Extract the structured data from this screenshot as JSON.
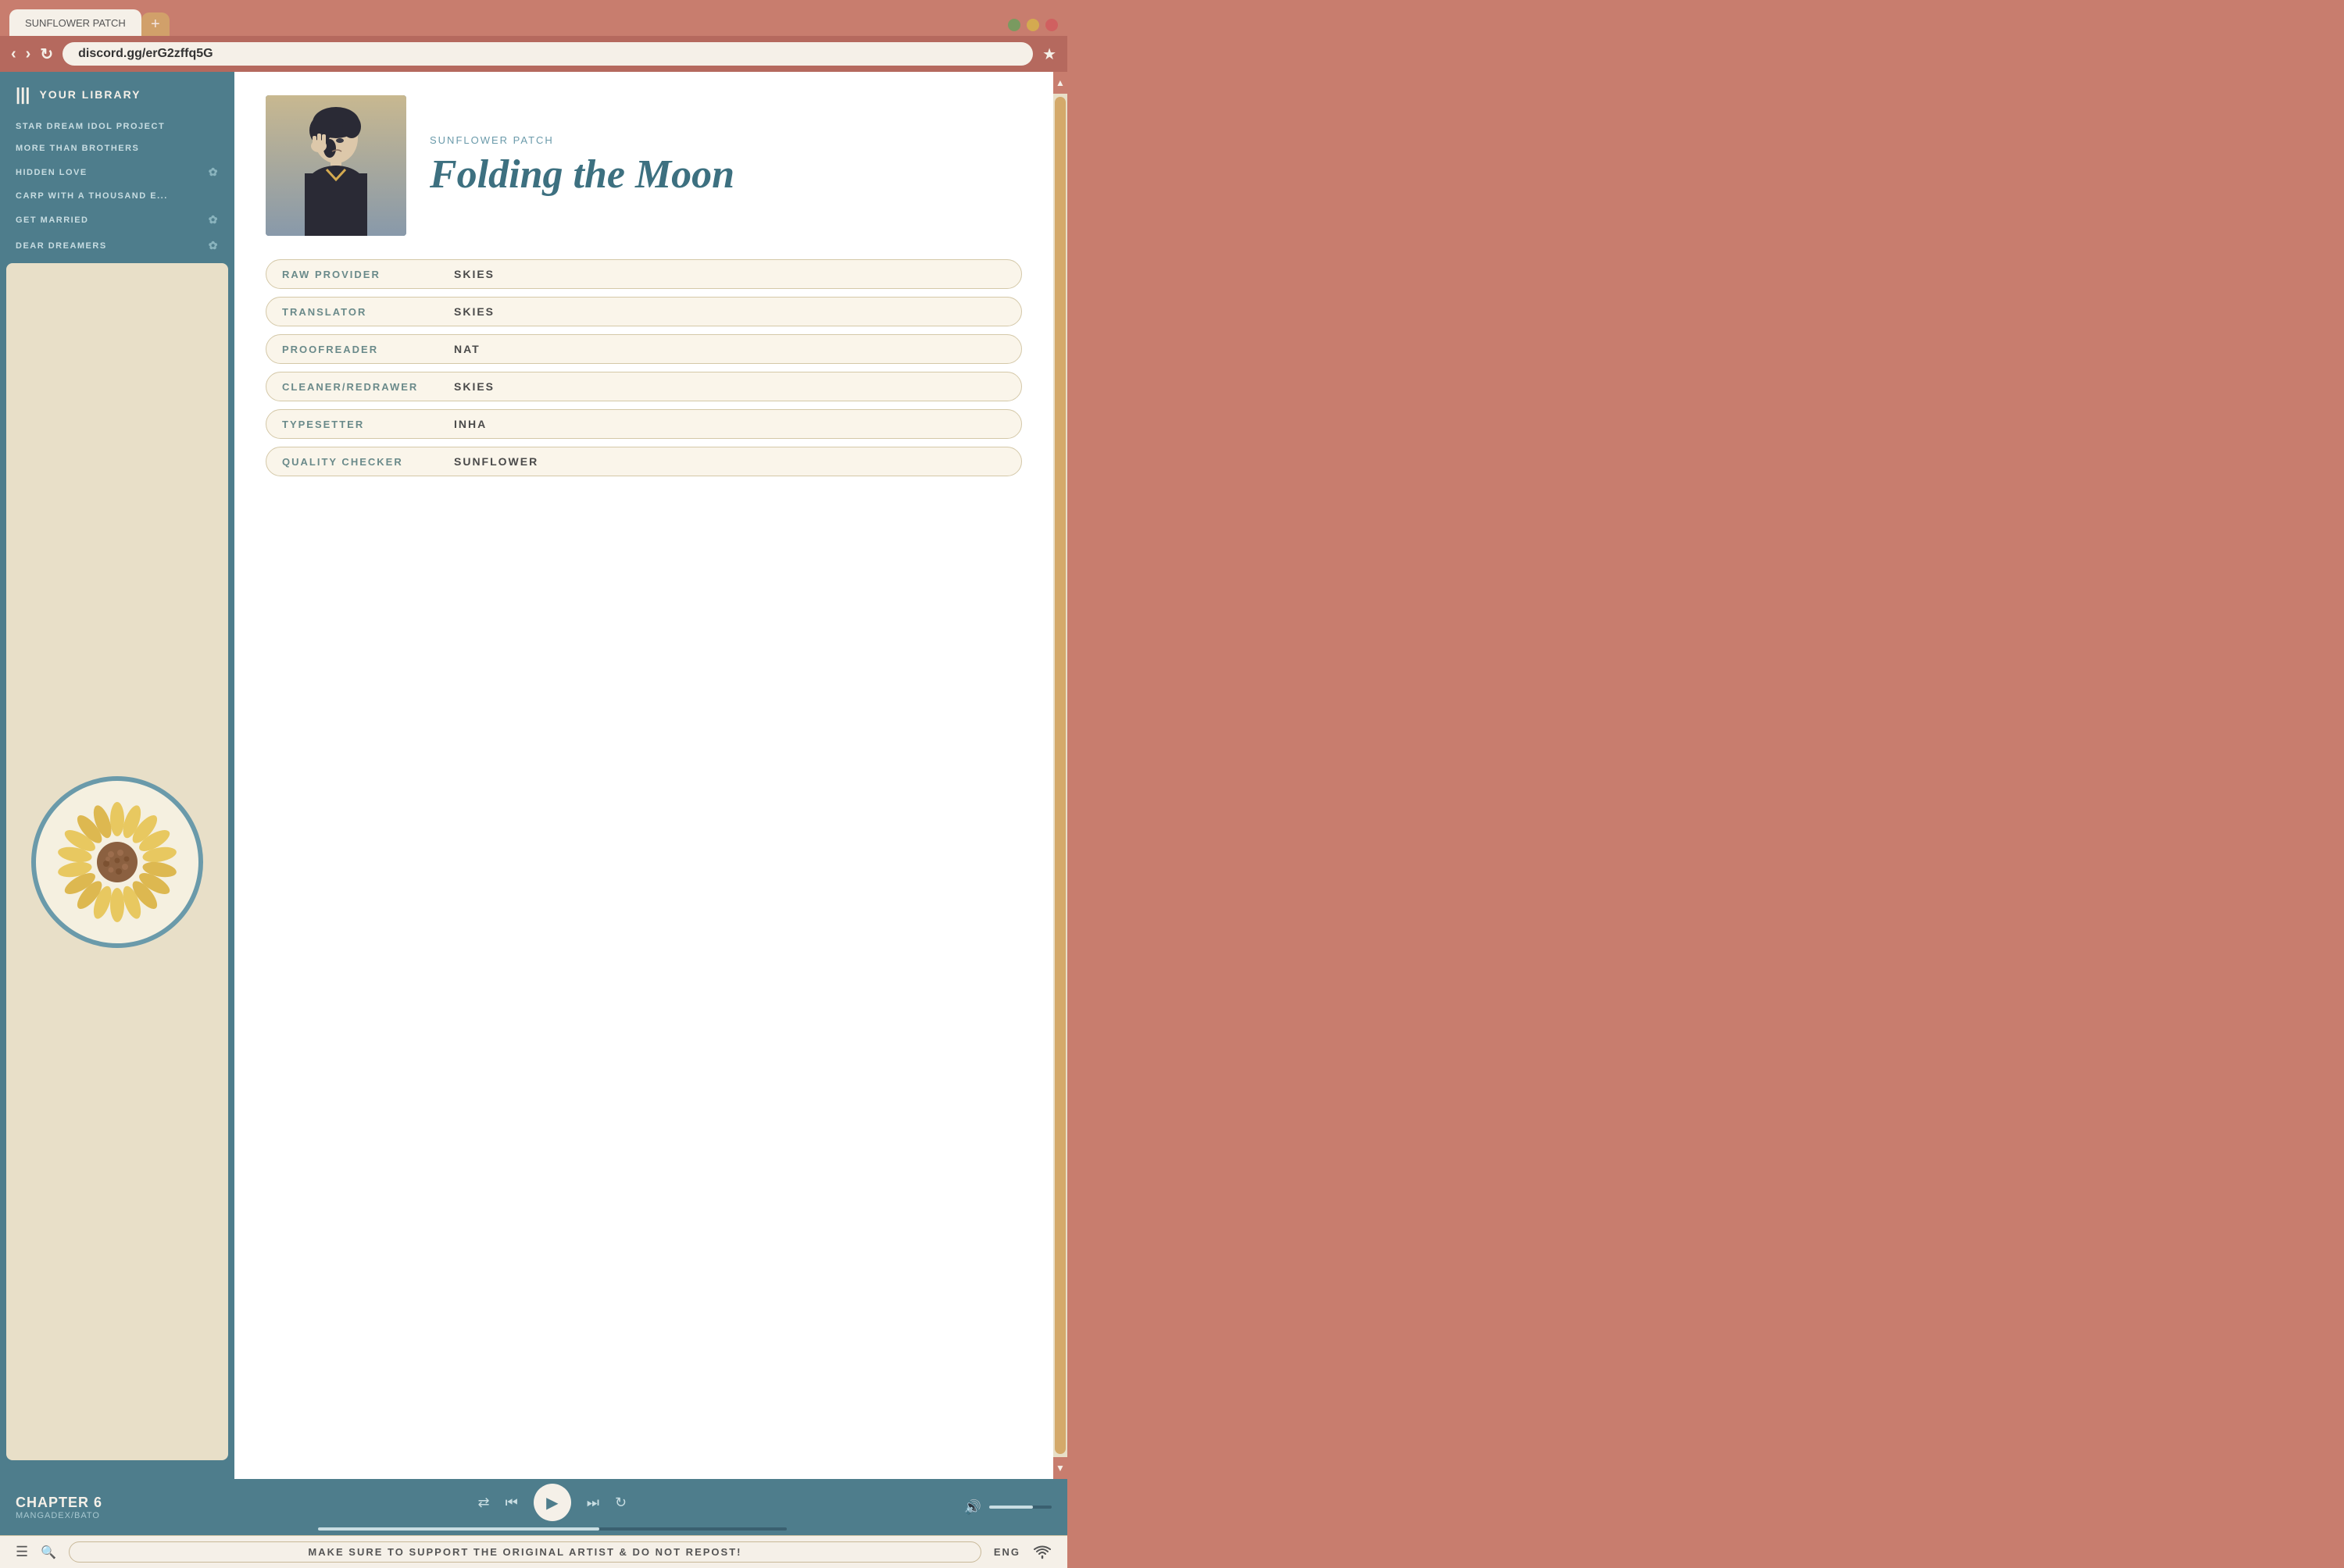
{
  "browser": {
    "tab_label": "SUNFLOWER PATCH",
    "tab_new_icon": "+",
    "url": "discord.gg/erG2zffq5G",
    "nav_back": "‹",
    "nav_forward": "›",
    "nav_refresh": "↻",
    "bookmark_icon": "★",
    "wc_colors": [
      "#7a9a60",
      "#d4aa50",
      "#d06060"
    ]
  },
  "sidebar": {
    "header_icon": "|||",
    "title": "YOUR LIBRARY",
    "items": [
      {
        "label": "STAR DREAM IDOL PROJECT",
        "icon": null
      },
      {
        "label": "MORE THAN BROTHERS",
        "icon": null
      },
      {
        "label": "HIDDEN LOVE",
        "icon": "✿"
      },
      {
        "label": "CARP WITH A THOUSAND E...",
        "icon": null
      },
      {
        "label": "GET MARRIED",
        "icon": "✿"
      },
      {
        "label": "DEAR DREAMERS",
        "icon": "✿"
      }
    ]
  },
  "manga": {
    "group": "SUNFLOWER PATCH",
    "title": "Folding the Moon",
    "credits": [
      {
        "label": "RAW PROVIDER",
        "value": "SKIES"
      },
      {
        "label": "TRANSLATOR",
        "value": "SKIES"
      },
      {
        "label": "PROOFREADER",
        "value": "NAT"
      },
      {
        "label": "CLEANER/REDRAWER",
        "value": "SKIES"
      },
      {
        "label": "TYPESETTER",
        "value": "INHA"
      },
      {
        "label": "QUALITY CHECKER",
        "value": "SUNFLOWER"
      }
    ]
  },
  "player": {
    "chapter": "CHAPTER 6",
    "sub": "MANGADEX/BATO",
    "shuffle_icon": "⇄",
    "prev_icon": "⏮",
    "play_icon": "▶",
    "next_icon": "⏭",
    "repeat_icon": "↻",
    "volume_icon": "🔊",
    "progress_pct": 60,
    "volume_pct": 70
  },
  "bottom_bar": {
    "menu_icon": "☰",
    "search_icon": "🔍",
    "notice": "MAKE SURE TO SUPPORT THE ORIGINAL ARTIST & DO NOT REPOST!",
    "lang": "ENG",
    "wifi_icon": "WiFi"
  },
  "scrollbar": {
    "up_icon": "▲",
    "down_icon": "▼"
  }
}
